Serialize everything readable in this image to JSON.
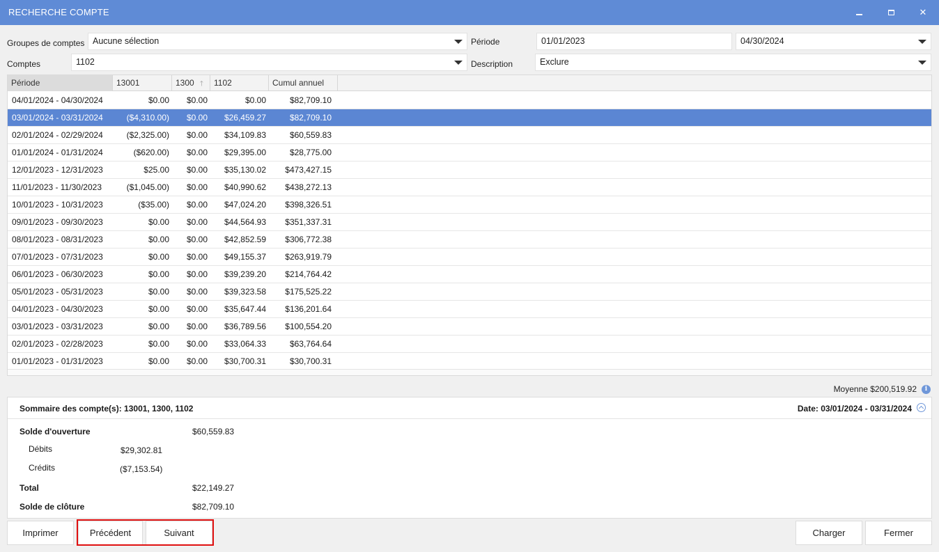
{
  "window": {
    "title": "RECHERCHE COMPTE"
  },
  "filters": {
    "groupes_label": "Groupes de comptes",
    "groupes_value": "Aucune sélection",
    "comptes_label": "Comptes",
    "comptes_value": "1102",
    "periode_label": "Période",
    "periode_start": "01/01/2023",
    "periode_end": "04/30/2024",
    "description_label": "Description",
    "description_value": "Exclure"
  },
  "grid": {
    "columns": [
      "Période",
      "13001",
      "1300",
      "1102",
      "Cumul annuel"
    ],
    "sorted_column": "1300",
    "selected_row": 1,
    "rows": [
      {
        "periode": "04/01/2024 - 04/30/2024",
        "c13001": "$0.00",
        "c1300": "$0.00",
        "c1102": "$0.00",
        "cumul": "$82,709.10"
      },
      {
        "periode": "03/01/2024 - 03/31/2024",
        "c13001": "($4,310.00)",
        "c1300": "$0.00",
        "c1102": "$26,459.27",
        "cumul": "$82,709.10"
      },
      {
        "periode": "02/01/2024 - 02/29/2024",
        "c13001": "($2,325.00)",
        "c1300": "$0.00",
        "c1102": "$34,109.83",
        "cumul": "$60,559.83"
      },
      {
        "periode": "01/01/2024 - 01/31/2024",
        "c13001": "($620.00)",
        "c1300": "$0.00",
        "c1102": "$29,395.00",
        "cumul": "$28,775.00"
      },
      {
        "periode": "12/01/2023 - 12/31/2023",
        "c13001": "$25.00",
        "c1300": "$0.00",
        "c1102": "$35,130.02",
        "cumul": "$473,427.15"
      },
      {
        "periode": "11/01/2023 - 11/30/2023",
        "c13001": "($1,045.00)",
        "c1300": "$0.00",
        "c1102": "$40,990.62",
        "cumul": "$438,272.13"
      },
      {
        "periode": "10/01/2023 - 10/31/2023",
        "c13001": "($35.00)",
        "c1300": "$0.00",
        "c1102": "$47,024.20",
        "cumul": "$398,326.51"
      },
      {
        "periode": "09/01/2023 - 09/30/2023",
        "c13001": "$0.00",
        "c1300": "$0.00",
        "c1102": "$44,564.93",
        "cumul": "$351,337.31"
      },
      {
        "periode": "08/01/2023 - 08/31/2023",
        "c13001": "$0.00",
        "c1300": "$0.00",
        "c1102": "$42,852.59",
        "cumul": "$306,772.38"
      },
      {
        "periode": "07/01/2023 - 07/31/2023",
        "c13001": "$0.00",
        "c1300": "$0.00",
        "c1102": "$49,155.37",
        "cumul": "$263,919.79"
      },
      {
        "periode": "06/01/2023 - 06/30/2023",
        "c13001": "$0.00",
        "c1300": "$0.00",
        "c1102": "$39,239.20",
        "cumul": "$214,764.42"
      },
      {
        "periode": "05/01/2023 - 05/31/2023",
        "c13001": "$0.00",
        "c1300": "$0.00",
        "c1102": "$39,323.58",
        "cumul": "$175,525.22"
      },
      {
        "periode": "04/01/2023 - 04/30/2023",
        "c13001": "$0.00",
        "c1300": "$0.00",
        "c1102": "$35,647.44",
        "cumul": "$136,201.64"
      },
      {
        "periode": "03/01/2023 - 03/31/2023",
        "c13001": "$0.00",
        "c1300": "$0.00",
        "c1102": "$36,789.56",
        "cumul": "$100,554.20"
      },
      {
        "periode": "02/01/2023 - 02/28/2023",
        "c13001": "$0.00",
        "c1300": "$0.00",
        "c1102": "$33,064.33",
        "cumul": "$63,764.64"
      },
      {
        "periode": "01/01/2023 - 01/31/2023",
        "c13001": "$0.00",
        "c1300": "$0.00",
        "c1102": "$30,700.31",
        "cumul": "$30,700.31"
      }
    ]
  },
  "moyenne": "Moyenne $200,519.92",
  "summary": {
    "title": "Sommaire des compte(s): 13001, 1300, 1102",
    "date": "Date: 03/01/2024 - 03/31/2024",
    "solde_ouverture_label": "Solde d'ouverture",
    "solde_ouverture_value": "$60,559.83",
    "debits_label": "Débits",
    "debits_value": "$29,302.81",
    "credits_label": "Crédits",
    "credits_value": "($7,153.54)",
    "total_label": "Total",
    "total_value": "$22,149.27",
    "solde_cloture_label": "Solde de clôture",
    "solde_cloture_value": "$82,709.10"
  },
  "buttons": {
    "imprimer": "Imprimer",
    "precedent": "Précédent",
    "suivant": "Suivant",
    "charger": "Charger",
    "fermer": "Fermer"
  },
  "colors": {
    "titlebar": "#5f8bd6",
    "selected_row": "#5b86d3",
    "highlight": "#e01010"
  }
}
